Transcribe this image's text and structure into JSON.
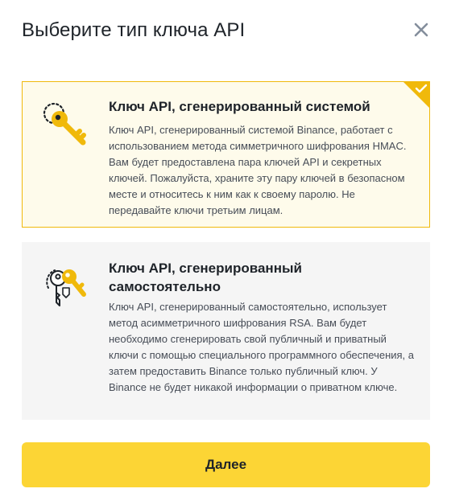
{
  "dialog": {
    "title": "Выберите тип ключа API",
    "close_icon": "close-icon"
  },
  "options": [
    {
      "title": "Ключ API, сгенерированный системой",
      "description": "Ключ API, сгенерированный системой Binance, работает с использованием метода симметричного шифрования HMAC. Вам будет предоставлена пара ключей API и секретных ключей. Пожалуйста, храните эту пару ключей в безопасном месте и относитесь к ним как к своему паролю. Не передавайте ключи третьим лицам.",
      "selected": true,
      "icon": "system-key-icon"
    },
    {
      "title": "Ключ API, сгенерированный самостоятельно",
      "description": "Ключ API, сгенерированный самостоятельно, использует метод асимметричного шифрования RSA. Вам будет необходимо сгенерировать свой публичный и приватный ключи с помощью специального программного обеспечения, а затем предоставить Binance только публичный ключ. У Binance не будет никакой информации о приватном ключе.",
      "selected": false,
      "icon": "self-generated-keys-icon"
    }
  ],
  "footer": {
    "next_label": "Далее"
  },
  "colors": {
    "accent": "#FCD535",
    "selected_border": "#F0B90B",
    "selected_bg": "#FEFBEB",
    "option_bg": "#F5F5F5",
    "text_primary": "#1E2329",
    "text_secondary": "#474D57"
  }
}
